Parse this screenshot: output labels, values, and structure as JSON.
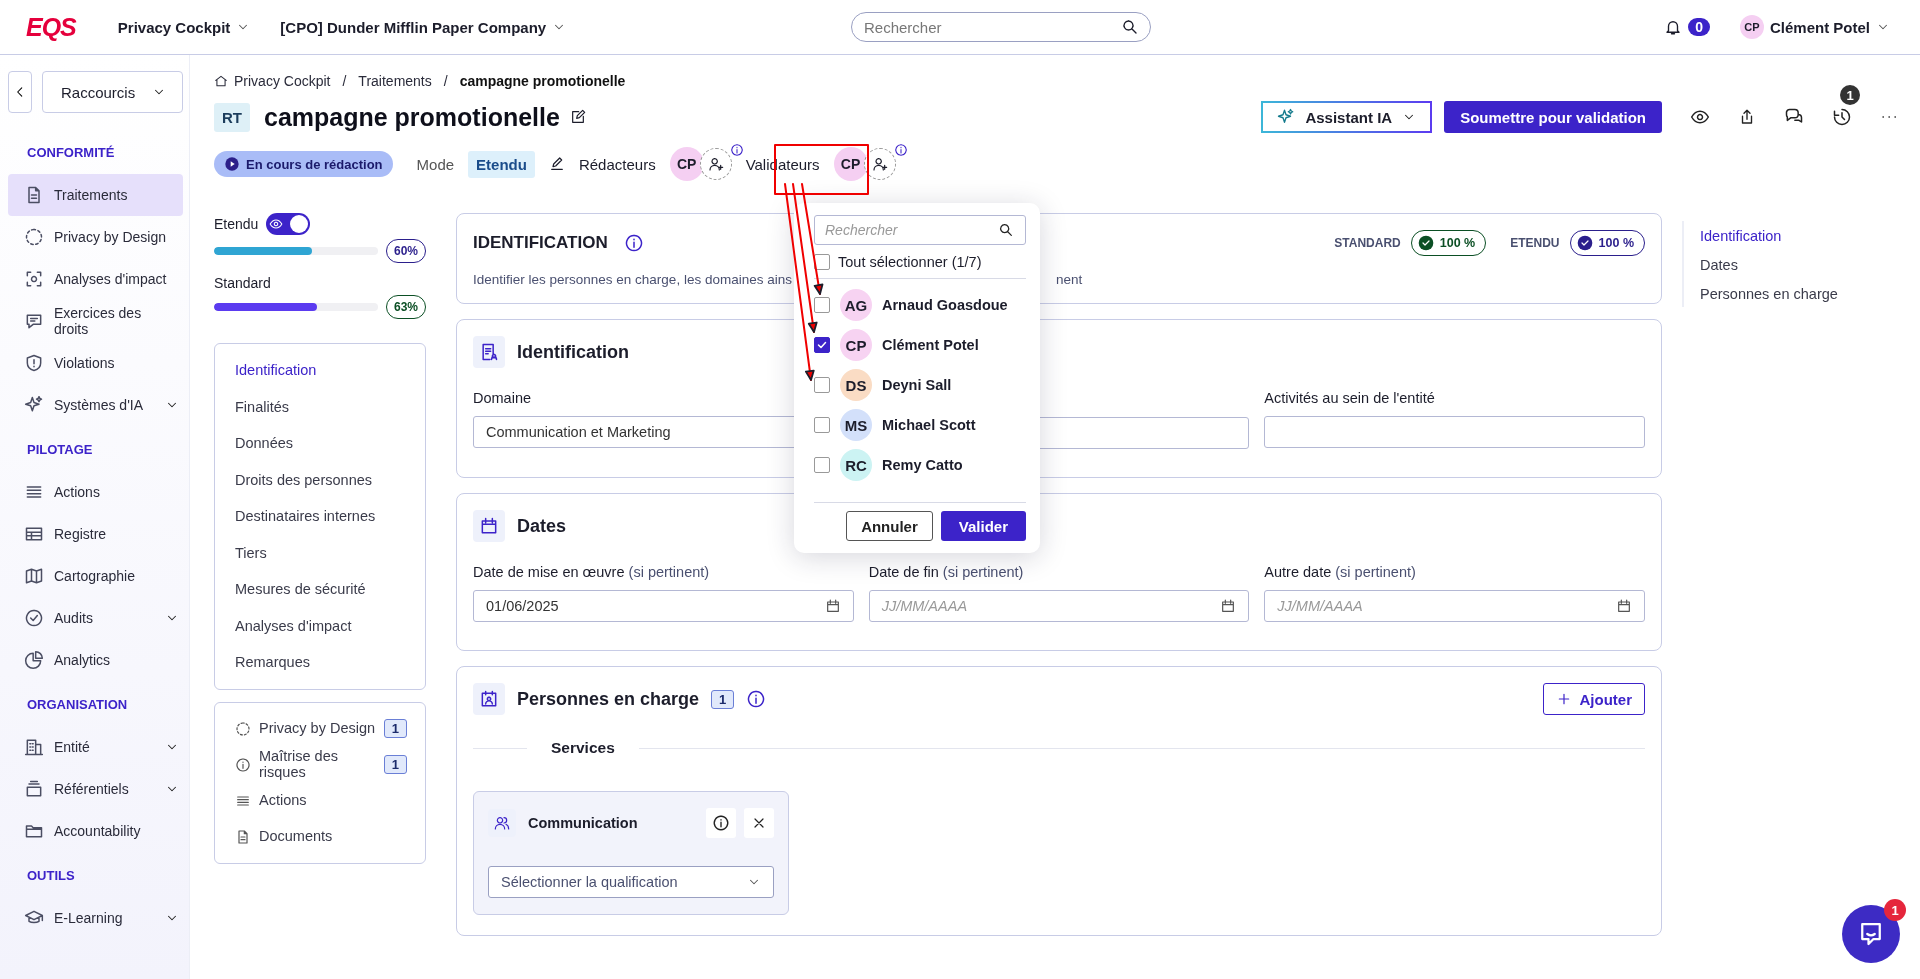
{
  "header": {
    "logo": "EQS",
    "app_menu": "Privacy Cockpit",
    "company_menu": "[CPO] Dunder Mifflin Paper Company",
    "search": {
      "placeholder": "Rechercher"
    },
    "notifications": "0",
    "user": {
      "initials": "CP",
      "name": "Clément Potel"
    }
  },
  "sidebar": {
    "shortcuts": "Raccourcis",
    "sections": [
      {
        "title": "CONFORMITÉ",
        "items": [
          {
            "label": "Traitements",
            "selected": true,
            "expandable": false
          },
          {
            "label": "Privacy by Design",
            "selected": false,
            "expandable": false
          },
          {
            "label": "Analyses d'impact",
            "selected": false,
            "expandable": false
          },
          {
            "label": "Exercices des droits",
            "selected": false,
            "expandable": false
          },
          {
            "label": "Violations",
            "selected": false,
            "expandable": false
          },
          {
            "label": "Systèmes d'IA",
            "selected": false,
            "expandable": true
          }
        ]
      },
      {
        "title": "PILOTAGE",
        "items": [
          {
            "label": "Actions",
            "selected": false,
            "expandable": false
          },
          {
            "label": "Registre",
            "selected": false,
            "expandable": false
          },
          {
            "label": "Cartographie",
            "selected": false,
            "expandable": false
          },
          {
            "label": "Audits",
            "selected": false,
            "expandable": true
          },
          {
            "label": "Analytics",
            "selected": false,
            "expandable": false
          }
        ]
      },
      {
        "title": "ORGANISATION",
        "items": [
          {
            "label": "Entité",
            "selected": false,
            "expandable": true
          },
          {
            "label": "Référentiels",
            "selected": false,
            "expandable": true
          },
          {
            "label": "Accountability",
            "selected": false,
            "expandable": false
          }
        ]
      },
      {
        "title": "OUTILS",
        "items": [
          {
            "label": "E-Learning",
            "selected": false,
            "expandable": true
          }
        ]
      }
    ]
  },
  "page": {
    "breadcrumb": [
      "Privacy Cockpit",
      "Traitements",
      "campagne promotionelle"
    ],
    "breadcrumb_separator": "/",
    "badge": "RT",
    "title": "campagne promotionelle",
    "status": "En cours de rédaction",
    "mode_label": "Mode",
    "mode": "Etendu",
    "redacteurs_label": "Rédacteurs",
    "redacteurs": [
      "CP"
    ],
    "validateurs_label": "Validateurs",
    "validateurs": [
      "CP"
    ],
    "assistant": "Assistant IA",
    "submit": "Soumettre pour validation",
    "history_count": "1"
  },
  "progress": {
    "toggle": {
      "label": "Etendu",
      "on": true
    },
    "bars": [
      {
        "level": 0.6,
        "reading": "60%",
        "color": "#2fa5d3"
      },
      {
        "label": "Standard",
        "level": 0.63,
        "reading": "63%",
        "color": "#5b3bf0"
      }
    ]
  },
  "section_nav": [
    {
      "label": "Identification",
      "selected": true
    },
    {
      "label": "Finalités",
      "selected": false
    },
    {
      "label": "Données",
      "selected": false
    },
    {
      "label": "Droits des personnes",
      "selected": false
    },
    {
      "label": "Destinataires internes",
      "selected": false
    },
    {
      "label": "Tiers",
      "selected": false
    },
    {
      "label": "Mesures de sécurité",
      "selected": false
    },
    {
      "label": "Analyses d'impact",
      "selected": false
    },
    {
      "label": "Remarques",
      "selected": false
    }
  ],
  "links": [
    {
      "label": "Privacy by Design",
      "count": "1"
    },
    {
      "label": "Maîtrise des risques",
      "count": "1"
    },
    {
      "label": "Actions"
    },
    {
      "label": "Documents"
    }
  ],
  "intro_card": {
    "title": "IDENTIFICATION",
    "description_start": "Identifier les personnes en charge, les domaines ains",
    "description_end": "nent",
    "scores": [
      {
        "label": "STANDARD",
        "value": "100 %",
        "color": "#0b4f24"
      },
      {
        "label": "ETENDU",
        "value": "100 %",
        "color": "#2b1f8c"
      }
    ]
  },
  "identification": {
    "title": "Identification",
    "fields": [
      {
        "kind": "text",
        "label": "Domaine",
        "value": "Communication et Marketing"
      },
      {
        "kind": "text"
      },
      {
        "kind": "text",
        "label": "Activités au sein de l'entité"
      }
    ]
  },
  "dates": {
    "title": "Dates",
    "fields": [
      {
        "label": "Date de mise en œuvre",
        "hint": "(si pertinent)",
        "value": "01/06/2025"
      },
      {
        "label": "Date de fin",
        "hint": "(si pertinent)",
        "placeholder": "JJ/MM/AAAA"
      },
      {
        "label": "Autre date",
        "hint": "(si pertinent)",
        "placeholder": "JJ/MM/AAAA"
      }
    ]
  },
  "persons": {
    "title": "Personnes en charge",
    "count": "1",
    "add": "Ajouter",
    "group": "Services",
    "services": [
      {
        "name": "Communication",
        "placeholder": "Sélectionner la qualification"
      }
    ]
  },
  "right_nav": [
    {
      "label": "Identification",
      "selected": true
    },
    {
      "label": "Dates",
      "selected": false
    },
    {
      "label": "Personnes en charge",
      "selected": false
    }
  ],
  "dropdown": {
    "search": {
      "placeholder": "Rechercher"
    },
    "select_all": {
      "label": "Tout sélectionner (1/7)",
      "checked": false
    },
    "people": [
      {
        "initials": "AG",
        "name": "Arnaud Goasdoue",
        "checked": false,
        "color": "#f7d3f2"
      },
      {
        "initials": "CP",
        "name": "Clément Potel",
        "checked": true,
        "color": "#f7d3f2"
      },
      {
        "initials": "DS",
        "name": "Deyni Sall",
        "checked": false,
        "color": "#fadcc4"
      },
      {
        "initials": "MS",
        "name": "Michael Scott",
        "checked": false,
        "color": "#d3e0fa"
      },
      {
        "initials": "RC",
        "name": "Remy Catto",
        "checked": false,
        "color": "#ccf3f3"
      }
    ],
    "cancel": "Annuler",
    "validate": "Valider"
  },
  "help_badge": "1"
}
